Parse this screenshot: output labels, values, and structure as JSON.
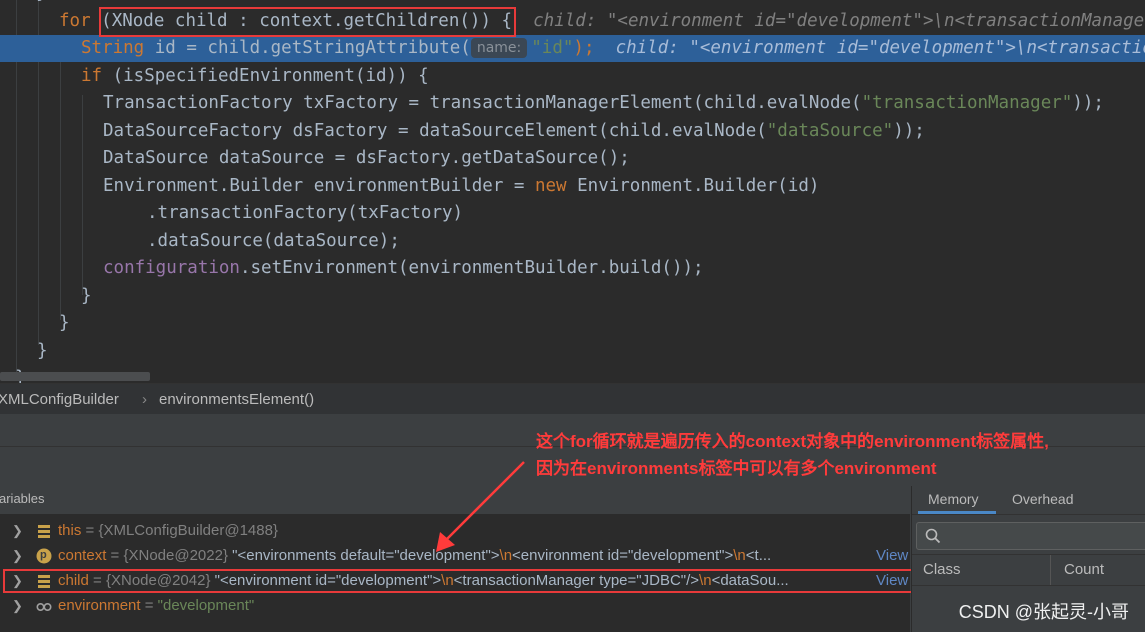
{
  "editor": {
    "for_kw": "for",
    "for_cond": "(XNode child : context.getChildren())",
    "for_brace": " {",
    "for_hint": "child: \"<environment id=\"development\">\\n<transactionManager type=\"JDBC\"/>\\n<dataSource",
    "l2_type": "String",
    "l2_code": " id = child.getStringAttribute(",
    "l2_param_hint": "name:",
    "l2_arg": "\"id\"",
    "l2_end": ");",
    "l2_hint": "child: \"<environment id=\"development\">\\n<transactionManager type=\"JDBC\"/>",
    "l3_kw": "if",
    "l3_code": " (isSpecifiedEnvironment(id)) {",
    "l4_code": "TransactionFactory txFactory = transactionManagerElement(child.evalNode(",
    "l4_str": "\"transactionManager\"",
    "l4_end": "));",
    "l5_code": "DataSourceFactory dsFactory = dataSourceElement(child.evalNode(",
    "l5_str": "\"dataSource\"",
    "l5_end": "));",
    "l6_code": "DataSource dataSource = dsFactory.getDataSource();",
    "l7_code": "Environment.Builder environmentBuilder = ",
    "l7_kw": "new",
    "l7_end": " Environment.Builder(id)",
    "l8_code": ".transactionFactory(txFactory)",
    "l9_code": ".dataSource(dataSource);",
    "l10_field": "configuration",
    "l10_code": ".setEnvironment(environmentBuilder.build());",
    "brace": "}"
  },
  "breadcrumb": {
    "class_name": "XMLConfigBuilder",
    "separator": "›",
    "method_name": "environmentsElement()"
  },
  "debug": {
    "variables_label": "ariables",
    "rows": [
      {
        "name": "this",
        "eq": " = ",
        "value": "{XMLConfigBuilder@1488}",
        "icon": "field-icon"
      },
      {
        "name": "context",
        "eq": " = ",
        "value": "{XNode@2022}",
        "str1": " \"<environments default=\"development\">",
        "esc1": "\\n",
        "str2": "<environment id=\"development\">",
        "esc2": "\\n",
        "str3": "<t...",
        "link": "View",
        "icon": "parameter-icon"
      },
      {
        "name": "child",
        "eq": " = ",
        "value": "{XNode@2042}",
        "str1": " \"<environment id=\"development\">",
        "esc1": "\\n",
        "str2": "<transactionManager type=\"JDBC\"/>",
        "esc2": "\\n",
        "str3": "<dataSou...",
        "link": "View",
        "icon": "field-icon"
      },
      {
        "name": "environment",
        "eq": " = ",
        "value": "\"development\"",
        "icon": "watch-icon"
      }
    ],
    "param_icon_letter": "p"
  },
  "memory": {
    "tab_memory": "Memory",
    "tab_overhead": "Overhead",
    "col_class": "Class",
    "col_count": "Count"
  },
  "annotation": {
    "line1": "这个for循环就是遍历传入的context对象中的environment标签属性,",
    "line2": "因为在environments标签中可以有多个environment"
  },
  "watermark": "CSDN @张起灵-小哥",
  "colors": {
    "accent_highlight": "#2d6099",
    "annotation_red": "#ff3b3b",
    "keyword": "#cc7832",
    "string": "#6a8759"
  }
}
